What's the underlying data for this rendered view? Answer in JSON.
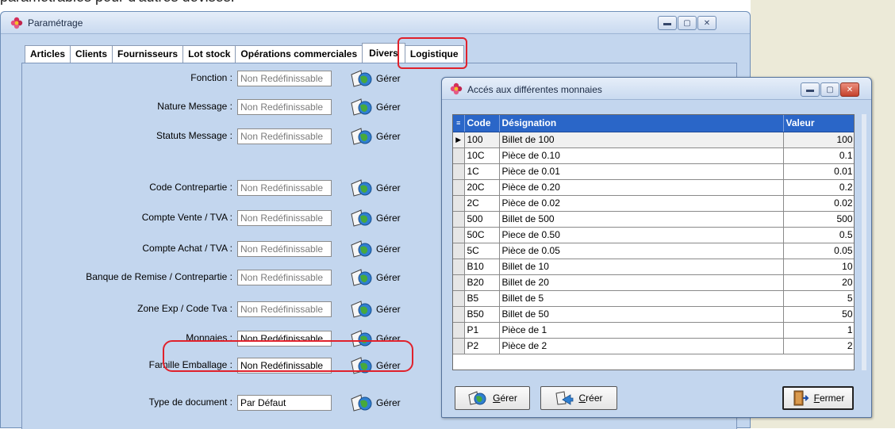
{
  "page_text": "paramétrables pour d'autres devises.",
  "main_window": {
    "title": "Paramétrage",
    "tabs": [
      {
        "label": "Articles"
      },
      {
        "label": "Clients"
      },
      {
        "label": "Fournisseurs"
      },
      {
        "label": "Lot stock"
      },
      {
        "label": "Opérations commerciales"
      },
      {
        "label": "Divers"
      },
      {
        "label": "Logistique"
      }
    ],
    "active_tab": "Divers",
    "manage_label": "Gérer",
    "rows": [
      {
        "label": "Fonction :",
        "value": "Non Redéfinissable"
      },
      {
        "label": "Nature Message :",
        "value": "Non Redéfinissable"
      },
      {
        "label": "Statuts Message :",
        "value": "Non Redéfinissable"
      },
      {
        "label": "Code Contrepartie :",
        "value": "Non Redéfinissable"
      },
      {
        "label": "Compte Vente / TVA :",
        "value": "Non Redéfinissable"
      },
      {
        "label": "Compte Achat / TVA :",
        "value": "Non Redéfinissable"
      },
      {
        "label": "Banque de Remise / Contrepartie :",
        "value": "Non Redéfinissable"
      },
      {
        "label": "Zone Exp / Code Tva :",
        "value": "Non Redéfinissable"
      },
      {
        "label": "Monnaies :",
        "value": "Non Redéfinissable"
      },
      {
        "label": "Famille Emballage :",
        "value": "Non Redéfinissable"
      },
      {
        "label": "Type de document :",
        "value": "Par Défaut"
      }
    ]
  },
  "child_window": {
    "title": "Accés aux différentes monnaies",
    "columns": [
      "Code",
      "Désignation",
      "Valeur"
    ],
    "rows": [
      {
        "code": "100",
        "designation": "Billet de 100",
        "valeur": "100"
      },
      {
        "code": "10C",
        "designation": "Pièce de 0.10",
        "valeur": "0.1"
      },
      {
        "code": "1C",
        "designation": "Pièce de 0.01",
        "valeur": "0.01"
      },
      {
        "code": "20C",
        "designation": "Pièce de 0.20",
        "valeur": "0.2"
      },
      {
        "code": "2C",
        "designation": "Pièce de 0.02",
        "valeur": "0.02"
      },
      {
        "code": "500",
        "designation": "Billet de 500",
        "valeur": "500"
      },
      {
        "code": "50C",
        "designation": "Piece de 0.50",
        "valeur": "0.5"
      },
      {
        "code": "5C",
        "designation": "Pièce de 0.05",
        "valeur": "0.05"
      },
      {
        "code": "B10",
        "designation": "Billet de 10",
        "valeur": "10"
      },
      {
        "code": "B20",
        "designation": "Billet de 20",
        "valeur": "20"
      },
      {
        "code": "B5",
        "designation": "Billet de 5",
        "valeur": "5"
      },
      {
        "code": "B50",
        "designation": "Billet de 50",
        "valeur": "50"
      },
      {
        "code": "P1",
        "designation": "Pièce de 1",
        "valeur": "1"
      },
      {
        "code": "P2",
        "designation": "Pièce de 2",
        "valeur": "2"
      }
    ],
    "selected_row": "100",
    "buttons": {
      "manage": {
        "hotkey": "G",
        "rest": "érer"
      },
      "create": {
        "hotkey": "C",
        "rest": "réer"
      },
      "close": {
        "hotkey": "F",
        "rest": "ermer"
      }
    }
  },
  "colors": {
    "window_bg": "#c3d6ee",
    "grid_header": "#2a66c8",
    "highlight": "#e0212b"
  }
}
